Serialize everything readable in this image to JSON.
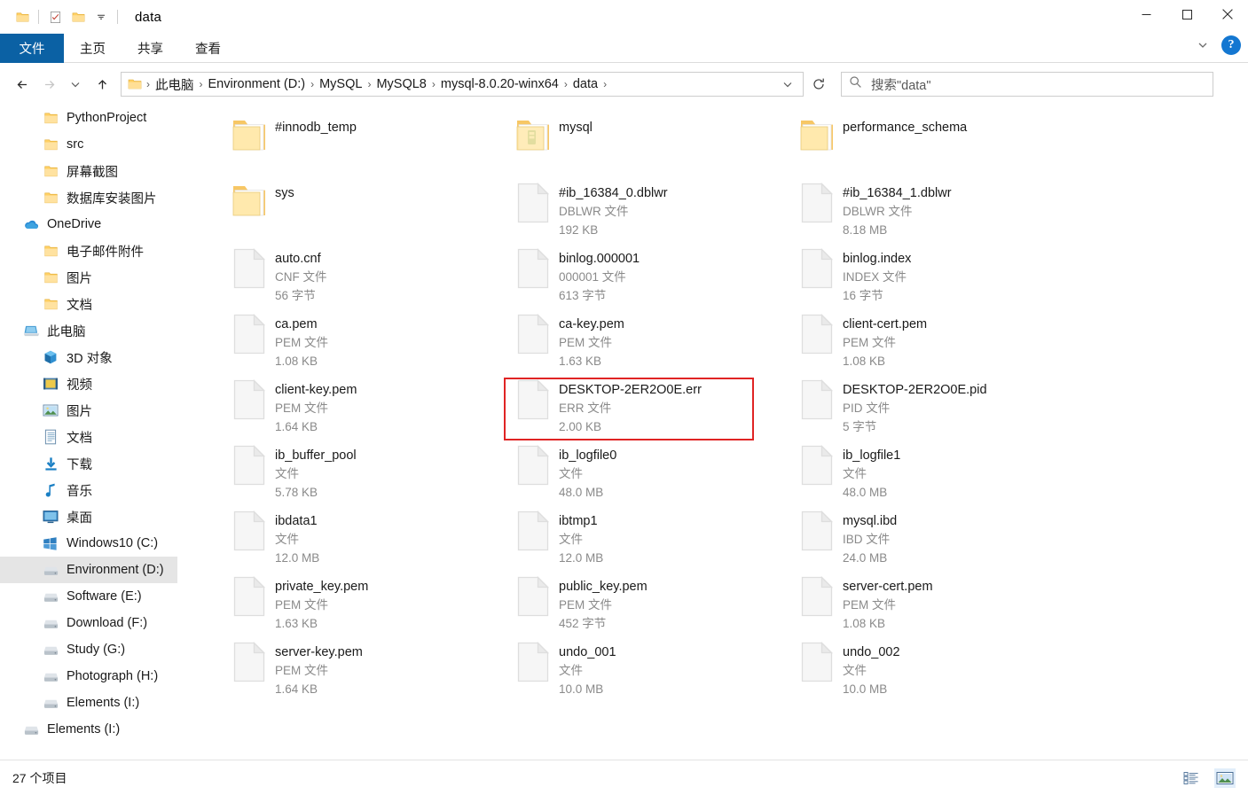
{
  "window": {
    "title": "data",
    "quick_access": [
      {
        "name": "folder-icon",
        "label": "folder"
      },
      {
        "name": "properties-icon",
        "label": "properties"
      },
      {
        "name": "new-folder-icon",
        "label": "new folder"
      },
      {
        "name": "customize-qat-icon",
        "label": "customize"
      }
    ],
    "controls": {
      "minimize": "minimize",
      "maximize": "maximize",
      "close": "close"
    }
  },
  "ribbon": {
    "tabs": [
      {
        "label": "文件",
        "active": true
      },
      {
        "label": "主页",
        "active": false
      },
      {
        "label": "共享",
        "active": false
      },
      {
        "label": "查看",
        "active": false
      }
    ],
    "collapse_label": "∨",
    "help_label": "?"
  },
  "address": {
    "back": "←",
    "forward": "→",
    "recent": "∨",
    "up": "↑",
    "crumbs": [
      "此电脑",
      "Environment (D:)",
      "MySQL",
      "MySQL8",
      "mysql-8.0.20-winx64",
      "data"
    ],
    "separator": "›",
    "dropdown": "∨",
    "refresh": "↻"
  },
  "search": {
    "icon": "search-icon",
    "placeholder": "搜索\"data\"",
    "value": "搜索\"data\""
  },
  "sidebar": {
    "items": [
      {
        "label": "PythonProject",
        "icon": "folder-icon",
        "indent": 2,
        "selected": false
      },
      {
        "label": "src",
        "icon": "folder-icon",
        "indent": 2,
        "selected": false
      },
      {
        "label": "屏幕截图",
        "icon": "folder-icon",
        "indent": 2,
        "selected": false
      },
      {
        "label": "数据库安装图片",
        "icon": "folder-icon",
        "indent": 2,
        "selected": false
      },
      {
        "label": "OneDrive",
        "icon": "onedrive-icon",
        "indent": 1,
        "selected": false
      },
      {
        "label": "电子邮件附件",
        "icon": "folder-icon",
        "indent": 2,
        "selected": false
      },
      {
        "label": "图片",
        "icon": "folder-icon",
        "indent": 2,
        "selected": false
      },
      {
        "label": "文档",
        "icon": "folder-icon",
        "indent": 2,
        "selected": false
      },
      {
        "label": "此电脑",
        "icon": "this-pc-icon",
        "indent": 1,
        "selected": false
      },
      {
        "label": "3D 对象",
        "icon": "3d-objects-icon",
        "indent": 2,
        "selected": false
      },
      {
        "label": "视频",
        "icon": "videos-icon",
        "indent": 2,
        "selected": false
      },
      {
        "label": "图片",
        "icon": "pictures-icon",
        "indent": 2,
        "selected": false
      },
      {
        "label": "文档",
        "icon": "documents-icon",
        "indent": 2,
        "selected": false
      },
      {
        "label": "下载",
        "icon": "downloads-icon",
        "indent": 2,
        "selected": false
      },
      {
        "label": "音乐",
        "icon": "music-icon",
        "indent": 2,
        "selected": false
      },
      {
        "label": "桌面",
        "icon": "desktop-icon",
        "indent": 2,
        "selected": false
      },
      {
        "label": "Windows10 (C:)",
        "icon": "windows-drive-icon",
        "indent": 2,
        "selected": false
      },
      {
        "label": "Environment (D:)",
        "icon": "drive-icon",
        "indent": 2,
        "selected": true
      },
      {
        "label": "Software (E:)",
        "icon": "drive-icon",
        "indent": 2,
        "selected": false
      },
      {
        "label": "Download (F:)",
        "icon": "drive-icon",
        "indent": 2,
        "selected": false
      },
      {
        "label": "Study (G:)",
        "icon": "drive-icon",
        "indent": 2,
        "selected": false
      },
      {
        "label": "Photograph (H:)",
        "icon": "drive-icon",
        "indent": 2,
        "selected": false
      },
      {
        "label": "Elements (I:)",
        "icon": "drive-icon",
        "indent": 2,
        "selected": false
      },
      {
        "label": "Elements (I:)",
        "icon": "drive-icon",
        "indent": 1,
        "selected": false
      }
    ]
  },
  "files": [
    {
      "name": "#innodb_temp",
      "type": "",
      "size": "",
      "kind": "folder",
      "highlighted": false
    },
    {
      "name": "mysql",
      "type": "",
      "size": "",
      "kind": "folder-special",
      "highlighted": false
    },
    {
      "name": "performance_schema",
      "type": "",
      "size": "",
      "kind": "folder",
      "highlighted": false
    },
    {
      "name": "sys",
      "type": "",
      "size": "",
      "kind": "folder",
      "highlighted": false
    },
    {
      "name": "#ib_16384_0.dblwr",
      "type": "DBLWR 文件",
      "size": "192 KB",
      "kind": "file",
      "highlighted": false
    },
    {
      "name": "#ib_16384_1.dblwr",
      "type": "DBLWR 文件",
      "size": "8.18 MB",
      "kind": "file",
      "highlighted": false
    },
    {
      "name": "auto.cnf",
      "type": "CNF 文件",
      "size": "56 字节",
      "kind": "file",
      "highlighted": false
    },
    {
      "name": "binlog.000001",
      "type": "000001 文件",
      "size": "613 字节",
      "kind": "file",
      "highlighted": false
    },
    {
      "name": "binlog.index",
      "type": "INDEX 文件",
      "size": "16 字节",
      "kind": "file",
      "highlighted": false
    },
    {
      "name": "ca.pem",
      "type": "PEM 文件",
      "size": "1.08 KB",
      "kind": "file",
      "highlighted": false
    },
    {
      "name": "ca-key.pem",
      "type": "PEM 文件",
      "size": "1.63 KB",
      "kind": "file",
      "highlighted": false
    },
    {
      "name": "client-cert.pem",
      "type": "PEM 文件",
      "size": "1.08 KB",
      "kind": "file",
      "highlighted": false
    },
    {
      "name": "client-key.pem",
      "type": "PEM 文件",
      "size": "1.64 KB",
      "kind": "file",
      "highlighted": false
    },
    {
      "name": "DESKTOP-2ER2O0E.err",
      "type": "ERR 文件",
      "size": "2.00 KB",
      "kind": "file",
      "highlighted": true
    },
    {
      "name": "DESKTOP-2ER2O0E.pid",
      "type": "PID 文件",
      "size": "5 字节",
      "kind": "file",
      "highlighted": false
    },
    {
      "name": "ib_buffer_pool",
      "type": "文件",
      "size": "5.78 KB",
      "kind": "file",
      "highlighted": false
    },
    {
      "name": "ib_logfile0",
      "type": "文件",
      "size": "48.0 MB",
      "kind": "file",
      "highlighted": false
    },
    {
      "name": "ib_logfile1",
      "type": "文件",
      "size": "48.0 MB",
      "kind": "file",
      "highlighted": false
    },
    {
      "name": "ibdata1",
      "type": "文件",
      "size": "12.0 MB",
      "kind": "file",
      "highlighted": false
    },
    {
      "name": "ibtmp1",
      "type": "文件",
      "size": "12.0 MB",
      "kind": "file",
      "highlighted": false
    },
    {
      "name": "mysql.ibd",
      "type": "IBD 文件",
      "size": "24.0 MB",
      "kind": "file",
      "highlighted": false
    },
    {
      "name": "private_key.pem",
      "type": "PEM 文件",
      "size": "1.63 KB",
      "kind": "file",
      "highlighted": false
    },
    {
      "name": "public_key.pem",
      "type": "PEM 文件",
      "size": "452 字节",
      "kind": "file",
      "highlighted": false
    },
    {
      "name": "server-cert.pem",
      "type": "PEM 文件",
      "size": "1.08 KB",
      "kind": "file",
      "highlighted": false
    },
    {
      "name": "server-key.pem",
      "type": "PEM 文件",
      "size": "1.64 KB",
      "kind": "file",
      "highlighted": false
    },
    {
      "name": "undo_001",
      "type": "文件",
      "size": "10.0 MB",
      "kind": "file",
      "highlighted": false
    },
    {
      "name": "undo_002",
      "type": "文件",
      "size": "10.0 MB",
      "kind": "file",
      "highlighted": false
    }
  ],
  "statusbar": {
    "item_count": "27 个项目",
    "views": [
      {
        "name": "details-view-toggle",
        "active": false
      },
      {
        "name": "large-icons-view-toggle",
        "active": true
      }
    ]
  },
  "colors": {
    "accent": "#0b61a4",
    "highlight": "#e02424",
    "folder": "#ffd064",
    "selection": "#e5e5e5"
  }
}
